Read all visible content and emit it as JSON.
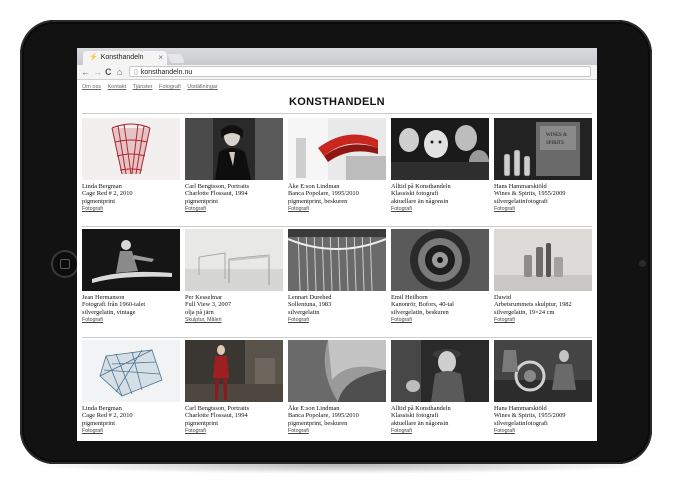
{
  "browser": {
    "tab_title": "Konsthandeln",
    "tab_close": "×",
    "url": "konsthandeln.nu",
    "back": "←",
    "forward": "→",
    "reload": "C",
    "home": "⌂"
  },
  "site": {
    "nav": [
      "Om oss",
      "Kontakt",
      "Tjänster",
      "Fotografi",
      "Utställningar"
    ],
    "logo": "KONSTHANDELN"
  },
  "colors": {
    "bezel": "#121212",
    "link": "#444444"
  },
  "rows": [
    [
      {
        "l1": "Linda Bergman",
        "l2": "Cage Red # 2, 2010",
        "l3": "pigmentprint",
        "tag": "Fotografi"
      },
      {
        "l1": "Carl Bengtsson, Portraits",
        "l2": "Charlotte Flossaut, 1994",
        "l3": "pigmentprint",
        "tag": "Fotografi"
      },
      {
        "l1": "Åke E:son Lindman",
        "l2": "Banca Popolare, 1995/2010",
        "l3": "pigmentprint, beskuren",
        "tag": "Fotografi"
      },
      {
        "l1": "Alltid på Konsthandeln",
        "l2": "Klassiskt fotografi",
        "l3": "aktuellare än någonsin",
        "tag": "Fotografi"
      },
      {
        "l1": "Hans Hammarskiöld",
        "l2": "Wines & Spirits, 1955/2009",
        "l3": "silvergelatinfotografi",
        "tag": "Fotografi"
      }
    ],
    [
      {
        "l1": "Jean Hermanson",
        "l2": "Fotografi från 1960-talet",
        "l3": "silvergelatin, vintage",
        "tag": "Fotografi"
      },
      {
        "l1": "Per Kesselmar",
        "l2": "Full View 3, 2007",
        "l3": "olja på järn",
        "tag": "Skulptur, Måleri"
      },
      {
        "l1": "Lennart Durehed",
        "l2": "Sollentuna, 1983",
        "l3": "silvergelatin",
        "tag": "Fotografi"
      },
      {
        "l1": "Emil Heilborn",
        "l2": "Kanonrör, Bofors, 40-tal",
        "l3": "silvergelatin, beskuren",
        "tag": "Fotografi"
      },
      {
        "l1": "Dawid",
        "l2": "Arbetsrummets skulptur, 1982",
        "l3": "silvergelatin, 19×24 cm",
        "tag": "Fotografi"
      }
    ],
    [
      {
        "l1": "Linda Bergman",
        "l2": "Cage Red # 2, 2010",
        "l3": "pigmentprint",
        "tag": "Fotografi"
      },
      {
        "l1": "Carl Bengtsson, Portraits",
        "l2": "Charlotte Flossaut, 1994",
        "l3": "pigmentprint",
        "tag": "Fotografi"
      },
      {
        "l1": "Åke E:son Lindman",
        "l2": "Banca Popolare, 1995/2010",
        "l3": "pigmentprint, beskuren",
        "tag": "Fotografi"
      },
      {
        "l1": "Alltid på Konsthandeln",
        "l2": "Klassiskt fotografi",
        "l3": "aktuellare än någonsin",
        "tag": "Fotografi"
      },
      {
        "l1": "Hans Hammarskiöld",
        "l2": "Wines & Spirits, 1955/2009",
        "l3": "silvergelatinfotografi",
        "tag": "Fotografi"
      }
    ]
  ]
}
